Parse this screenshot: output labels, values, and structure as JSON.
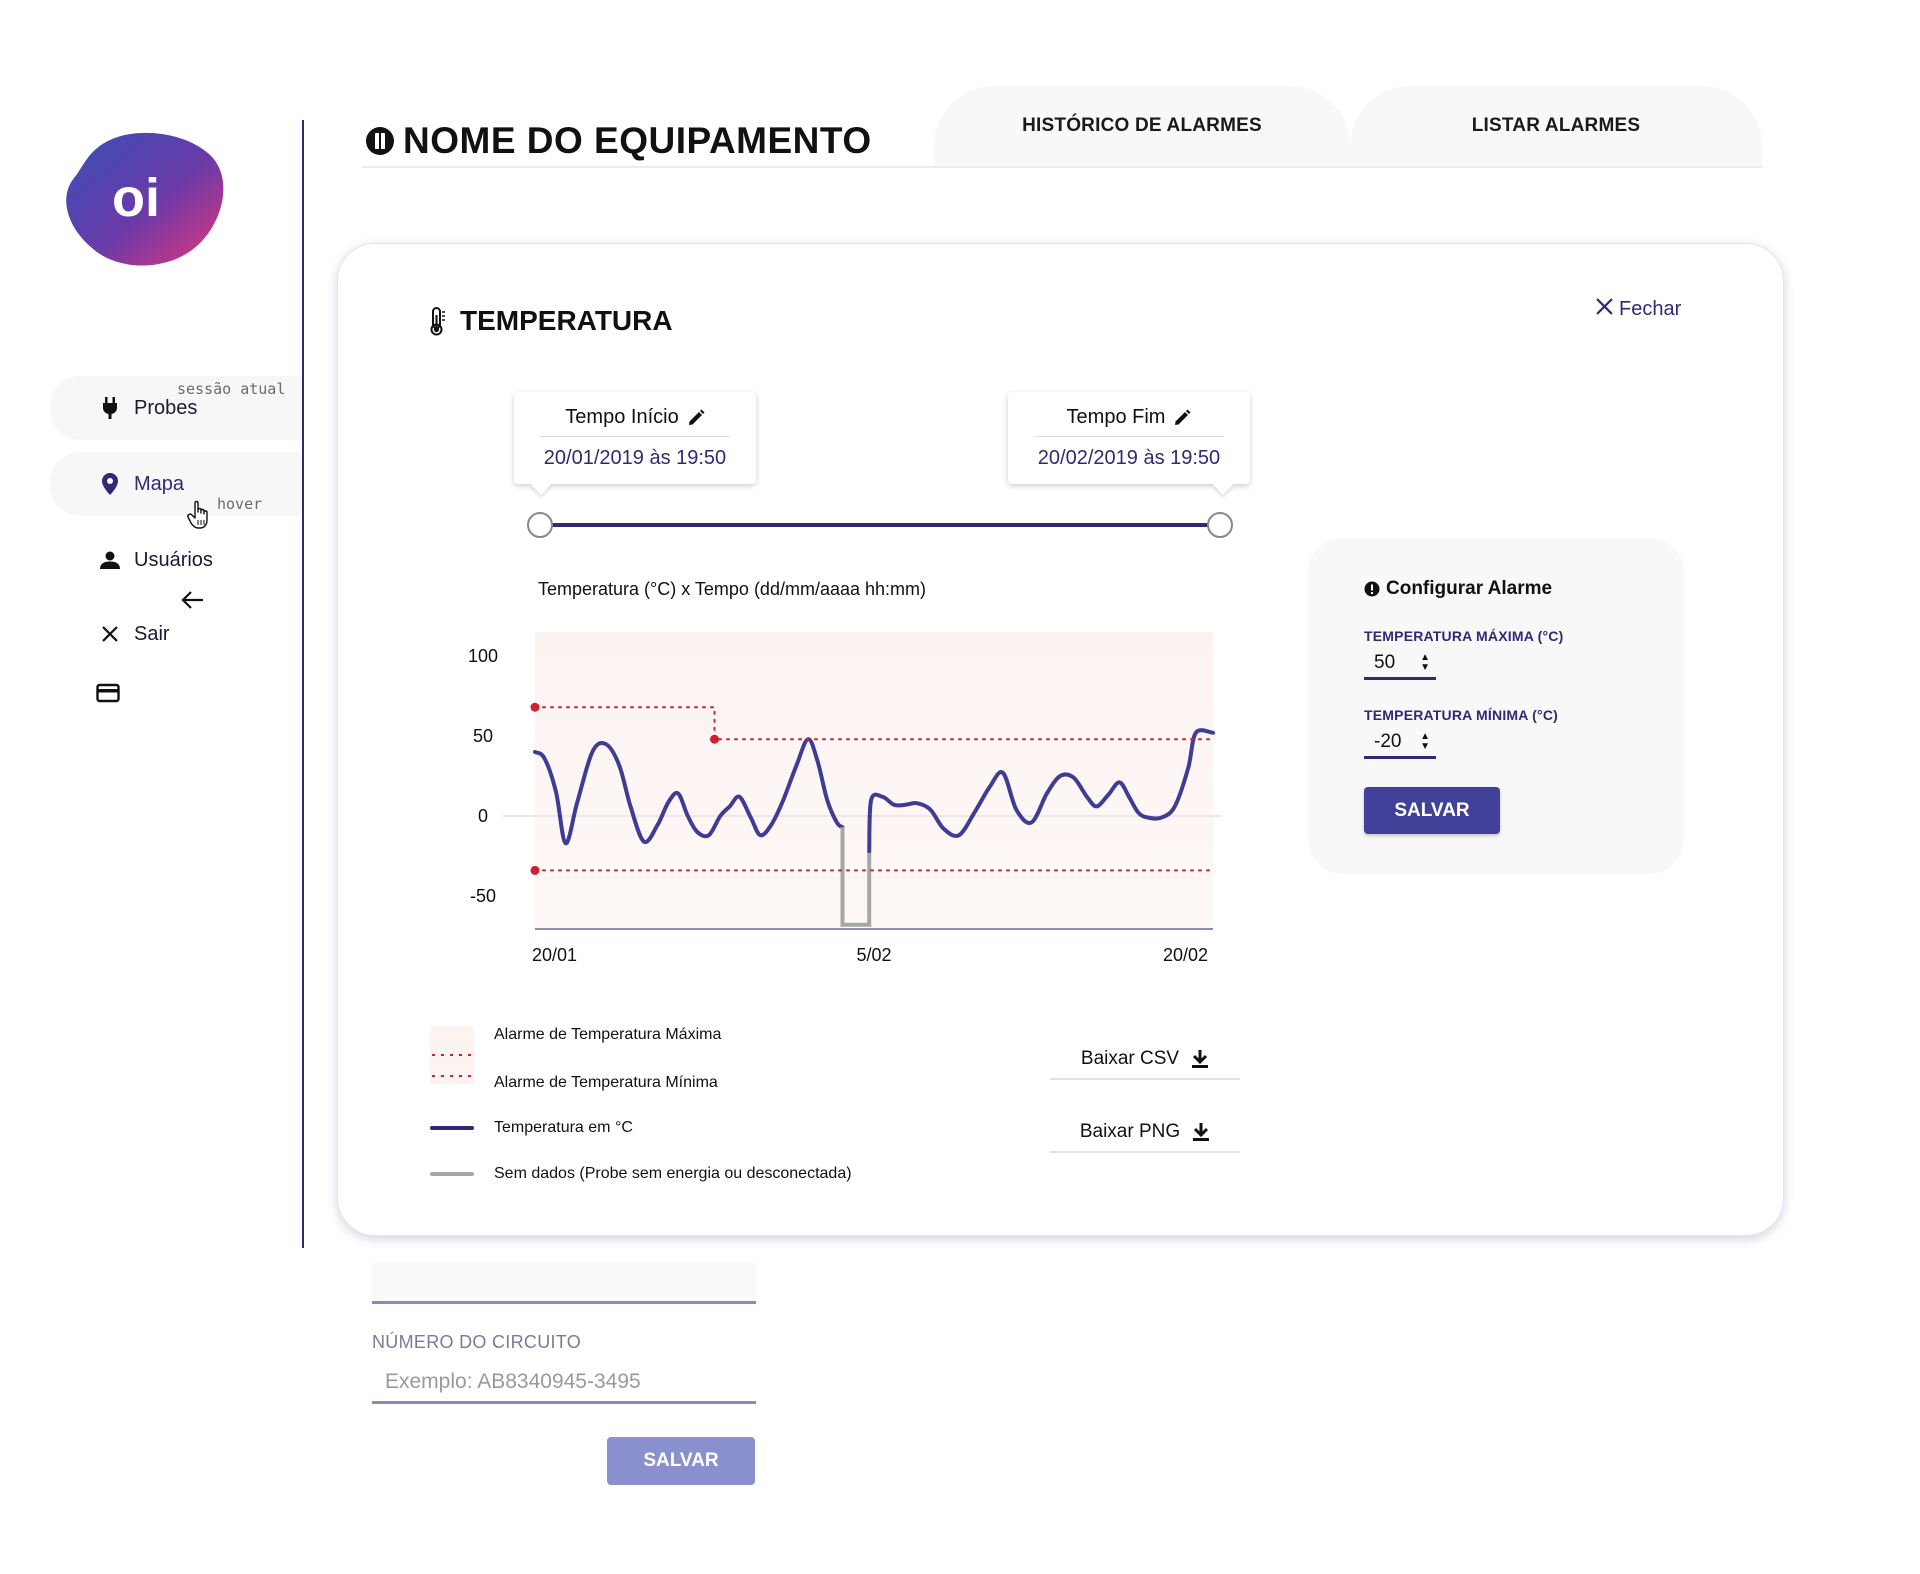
{
  "brand": {
    "logo_text": "oi"
  },
  "sidebar": {
    "items": [
      {
        "label": "Probes",
        "icon": "plug-icon"
      },
      {
        "label": "Mapa",
        "icon": "map-pin-icon"
      },
      {
        "label": "Usuários",
        "icon": "user-icon"
      },
      {
        "label": "Sair",
        "icon": "close-icon"
      }
    ],
    "annotations": {
      "current_session": "sessão atual",
      "hover": "hover"
    }
  },
  "header": {
    "title": "NOME DO EQUIPAMENTO",
    "tabs": [
      {
        "label": "HISTÓRICO DE ALARMES"
      },
      {
        "label": "LISTAR ALARMES"
      }
    ]
  },
  "modal": {
    "title": "TEMPERATURA",
    "close_label": "Fechar",
    "time_start": {
      "label": "Tempo Início",
      "value": "20/01/2019 às 19:50"
    },
    "time_end": {
      "label": "Tempo Fim",
      "value": "20/02/2019 às 19:50"
    },
    "range_selection": [
      0,
      1
    ]
  },
  "legend": {
    "max_alarm": "Alarme de Temperatura Máxima",
    "min_alarm": "Alarme de Temperatura Mínima",
    "temperature": "Temperatura em °C",
    "no_data": "Sem dados (Probe sem energia ou desconectada)"
  },
  "downloads": {
    "csv": "Baixar CSV",
    "png": "Baixar PNG"
  },
  "alarm_config": {
    "title": "Configurar Alarme",
    "max_label": "TEMPERATURA MÁXIMA (°C)",
    "max_value": "50",
    "min_label": "TEMPERATURA MÍNIMA (°C)",
    "min_value": "-20",
    "save_label": "SALVAR"
  },
  "background_form": {
    "circuit_label": "NÚMERO DO CIRCUITO",
    "circuit_placeholder": "Exemplo: AB8340945-3495",
    "save_label": "SALVAR"
  },
  "colors": {
    "primary": "#2e2a76",
    "button": "#42419a",
    "alarm": "#d0202e",
    "no_data": "#a6a6a6"
  },
  "chart_data": {
    "type": "line",
    "title": "Temperatura (°C) x Tempo (dd/mm/aaaa hh:mm)",
    "xlabel": "",
    "ylabel": "",
    "x_ticks": [
      "20/01",
      "5/02",
      "20/02"
    ],
    "y_ticks": [
      100,
      50,
      0,
      -50
    ],
    "xlim": [
      0,
      31
    ],
    "ylim": [
      -70,
      115
    ],
    "grid": false,
    "series": [
      {
        "name": "Temperatura em °C",
        "color": "#3e3c94",
        "points": [
          [
            0.0,
            40
          ],
          [
            0.5,
            36
          ],
          [
            1.1,
            15
          ],
          [
            1.6,
            -17
          ],
          [
            2.2,
            8
          ],
          [
            3.0,
            40
          ],
          [
            3.7,
            45
          ],
          [
            4.4,
            32
          ],
          [
            5.0,
            6
          ],
          [
            5.7,
            -16
          ],
          [
            6.4,
            -6
          ],
          [
            7.0,
            9
          ],
          [
            7.5,
            14
          ],
          [
            8.0,
            0
          ],
          [
            8.5,
            -10
          ],
          [
            9.1,
            -12
          ],
          [
            9.7,
            0
          ],
          [
            10.2,
            6
          ],
          [
            10.7,
            12
          ],
          [
            11.3,
            -1
          ],
          [
            11.8,
            -12
          ],
          [
            12.4,
            -5
          ],
          [
            13.0,
            10
          ],
          [
            13.7,
            32
          ],
          [
            14.3,
            48
          ],
          [
            14.8,
            34
          ],
          [
            15.3,
            10
          ],
          [
            15.8,
            -4
          ],
          [
            16.1,
            -7
          ]
        ]
      },
      {
        "name": "Temperatura em °C",
        "color": "#3e3c94",
        "points": [
          [
            17.5,
            -23
          ],
          [
            17.6,
            10
          ],
          [
            18.2,
            12
          ],
          [
            18.8,
            7
          ],
          [
            19.4,
            7
          ],
          [
            20.0,
            8
          ],
          [
            20.7,
            4
          ],
          [
            21.4,
            -8
          ],
          [
            22.2,
            -12
          ],
          [
            23.0,
            2
          ],
          [
            23.8,
            18
          ],
          [
            24.5,
            27
          ],
          [
            25.2,
            4
          ],
          [
            26.0,
            -4
          ],
          [
            26.8,
            14
          ],
          [
            27.5,
            25
          ],
          [
            28.2,
            24
          ],
          [
            28.9,
            12
          ],
          [
            29.4,
            6
          ],
          [
            30.0,
            13
          ],
          [
            30.6,
            21
          ],
          [
            31.1,
            12
          ],
          [
            31.6,
            2
          ],
          [
            32.1,
            -1
          ],
          [
            32.8,
            -1
          ],
          [
            33.5,
            6
          ],
          [
            34.2,
            30
          ],
          [
            34.6,
            52
          ],
          [
            35.5,
            52
          ]
        ]
      },
      {
        "name": "Sem dados (Probe sem energia ou desconectada)",
        "color": "#a6a6a6",
        "points": [
          [
            16.1,
            -7
          ],
          [
            16.1,
            -68
          ],
          [
            17.5,
            -68
          ],
          [
            17.5,
            -23
          ]
        ]
      },
      {
        "name": "Alarme de Temperatura Máxima",
        "color": "#d0202e",
        "dashed": true,
        "points": [
          [
            0,
            68
          ],
          [
            9.4,
            68
          ],
          [
            9.4,
            48
          ],
          [
            35.5,
            48
          ]
        ]
      },
      {
        "name": "Alarme de Temperatura Mínima",
        "color": "#d0202e",
        "dashed": true,
        "points": [
          [
            0,
            -34
          ],
          [
            35.5,
            -34
          ]
        ]
      }
    ]
  }
}
